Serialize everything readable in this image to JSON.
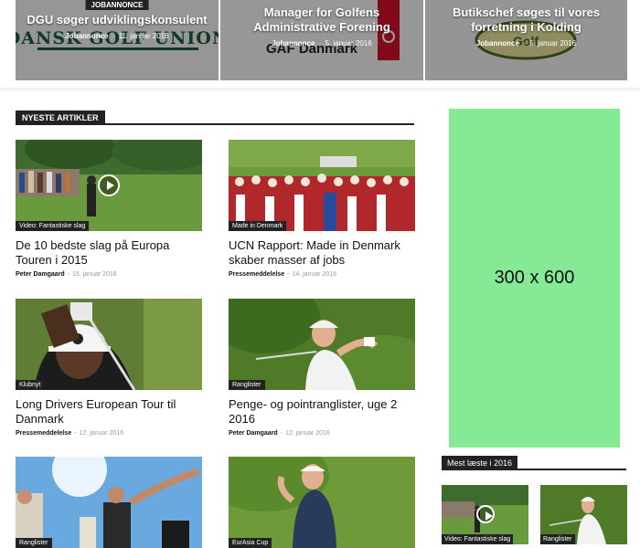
{
  "featured": [
    {
      "title": "DGU søger udviklingskonsulent",
      "badge": "JOBANNONCE",
      "category": "Jobannonce",
      "sep": "-",
      "date": "11. januar 2016",
      "logo_text": "DANSK GOLF UNION"
    },
    {
      "title": "Manager for Golfens Administrative Forening",
      "category": "Jobannonce",
      "sep": "-",
      "date": "5. januar 2016",
      "logo_text": "GAF Danmark"
    },
    {
      "title": "Butikschef søges til vores forretning i Kolding",
      "category": "Jobannonce",
      "sep": "-",
      "date": "5. januar 2016",
      "logo_text": "Golf"
    }
  ],
  "section_title": "NYESTE ARTIKLER",
  "articles": [
    {
      "category": "Video: Fantastiske slag",
      "title": "De 10 bedste slag på Europa Touren i 2015",
      "author": "Peter Damgaard",
      "sep": "-",
      "date": "15. januar 2016"
    },
    {
      "category": "Made in Denmark",
      "title": "UCN Rapport: Made in Denmark skaber masser af jobs",
      "author": "Pressemeddelelse",
      "sep": "-",
      "date": "14. januar 2016"
    },
    {
      "category": "Klubnyt",
      "title": "Long Drivers European Tour til Danmark",
      "author": "Pressemeddelelse",
      "sep": "-",
      "date": "12. januar 2016"
    },
    {
      "category": "Ranglister",
      "title": "Penge- og pointranglister, uge 2 2016",
      "author": "Peter Damgaard",
      "sep": "-",
      "date": "12. januar 2016"
    },
    {
      "category": "Ranglister"
    },
    {
      "category": "EurAsia Cup"
    }
  ],
  "ad": {
    "label": "300 x 600"
  },
  "most_read": {
    "title": "Mest læste i 2016",
    "items": [
      {
        "category": "Video: Fantastiske slag"
      },
      {
        "category": "Ranglister"
      }
    ]
  },
  "colors": {
    "ad_bg": "#86e996",
    "dark": "#222222",
    "gaf_red": "#d0102a"
  }
}
